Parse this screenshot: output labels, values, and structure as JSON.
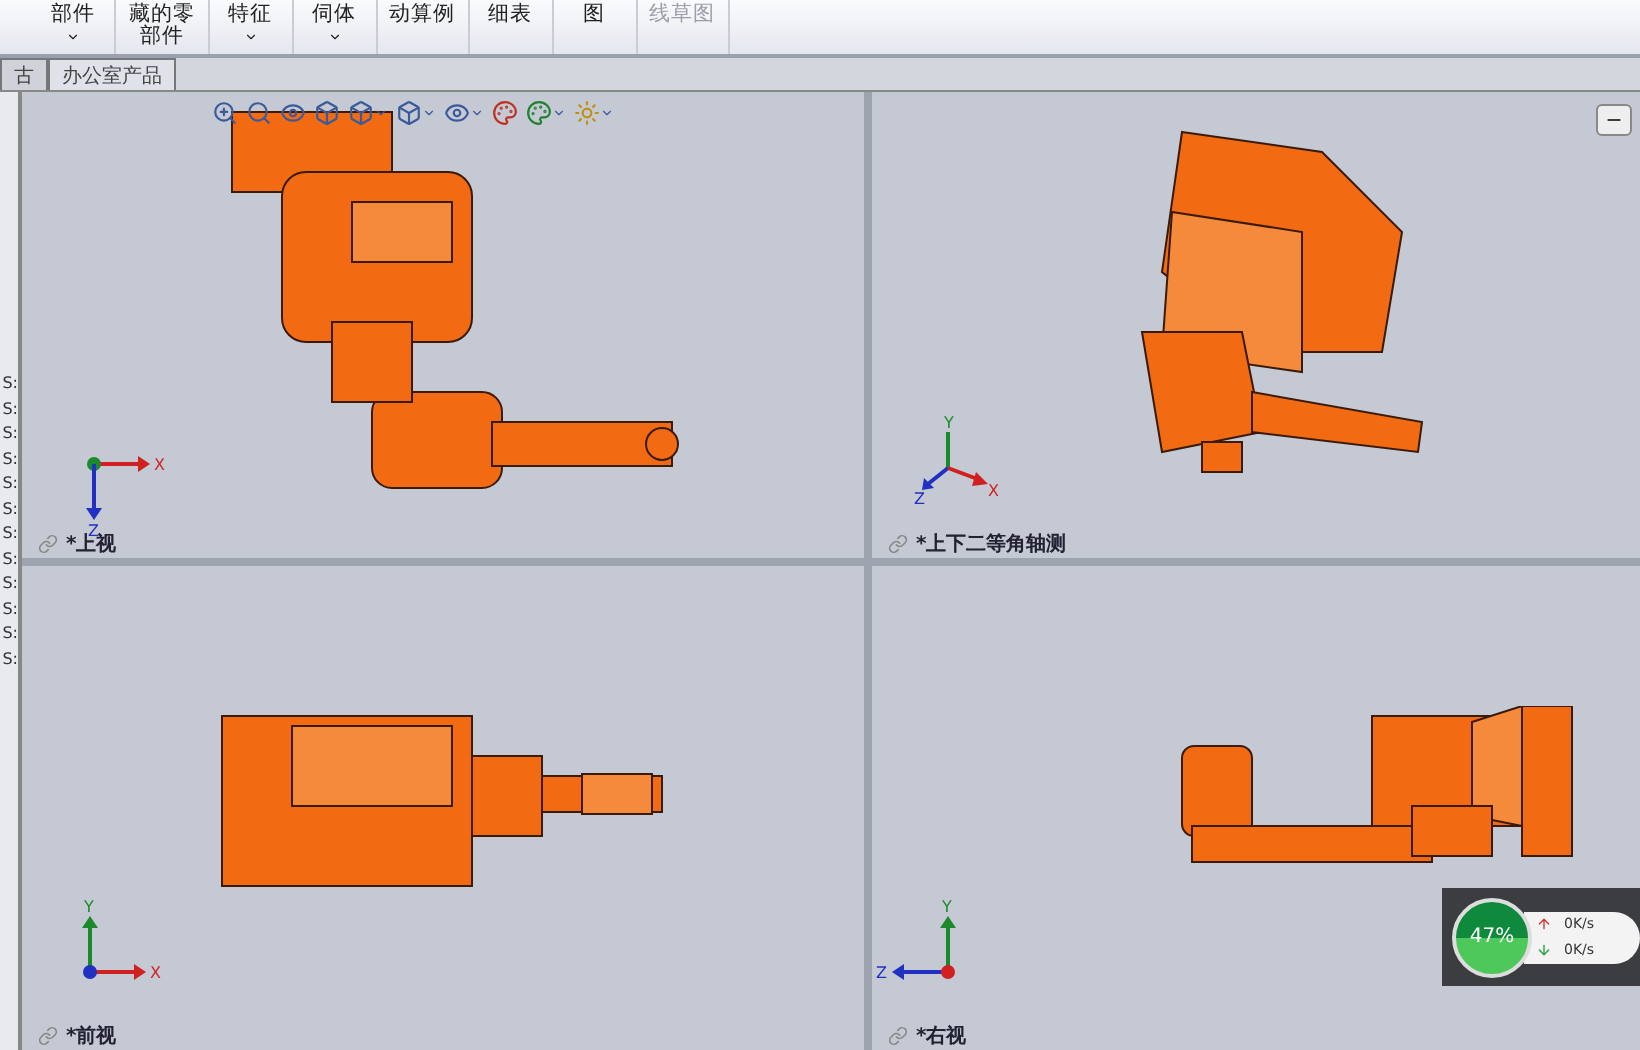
{
  "toolbar": {
    "buttons": [
      {
        "label": "部件",
        "dropdown": true,
        "disabled": false
      },
      {
        "label": "藏的零部件",
        "dropdown": false,
        "disabled": false
      },
      {
        "label": "特征",
        "dropdown": true,
        "disabled": false
      },
      {
        "label": "伺体",
        "dropdown": true,
        "disabled": false
      },
      {
        "label": "动算例",
        "dropdown": false,
        "disabled": false
      },
      {
        "label": "细表",
        "dropdown": false,
        "disabled": false
      },
      {
        "label": "图",
        "dropdown": false,
        "disabled": false
      },
      {
        "label": "线草图",
        "dropdown": false,
        "disabled": true
      }
    ]
  },
  "tabs": [
    {
      "label": "古",
      "selected": false
    },
    {
      "label": "办公室产品",
      "selected": true
    }
  ],
  "left_panel": {
    "items": [
      "S:",
      "S:",
      "S:",
      "S:",
      "S:",
      "S:",
      "S:",
      "S:",
      "S:",
      "S:",
      "S:",
      "S:"
    ]
  },
  "viewports": [
    {
      "label": "*上视",
      "kind": "top",
      "axes": [
        "X",
        "Z"
      ]
    },
    {
      "label": "*上下二等角轴测",
      "kind": "iso",
      "axes": [
        "Y",
        "Z",
        "X"
      ]
    },
    {
      "label": "*前视",
      "kind": "front",
      "axes": [
        "Y",
        "X"
      ]
    },
    {
      "label": "*右视",
      "kind": "right",
      "axes": [
        "Y",
        "Z"
      ]
    }
  ],
  "network_widget": {
    "percent": "47%",
    "upload": "0K/s",
    "download": "0K/s"
  }
}
